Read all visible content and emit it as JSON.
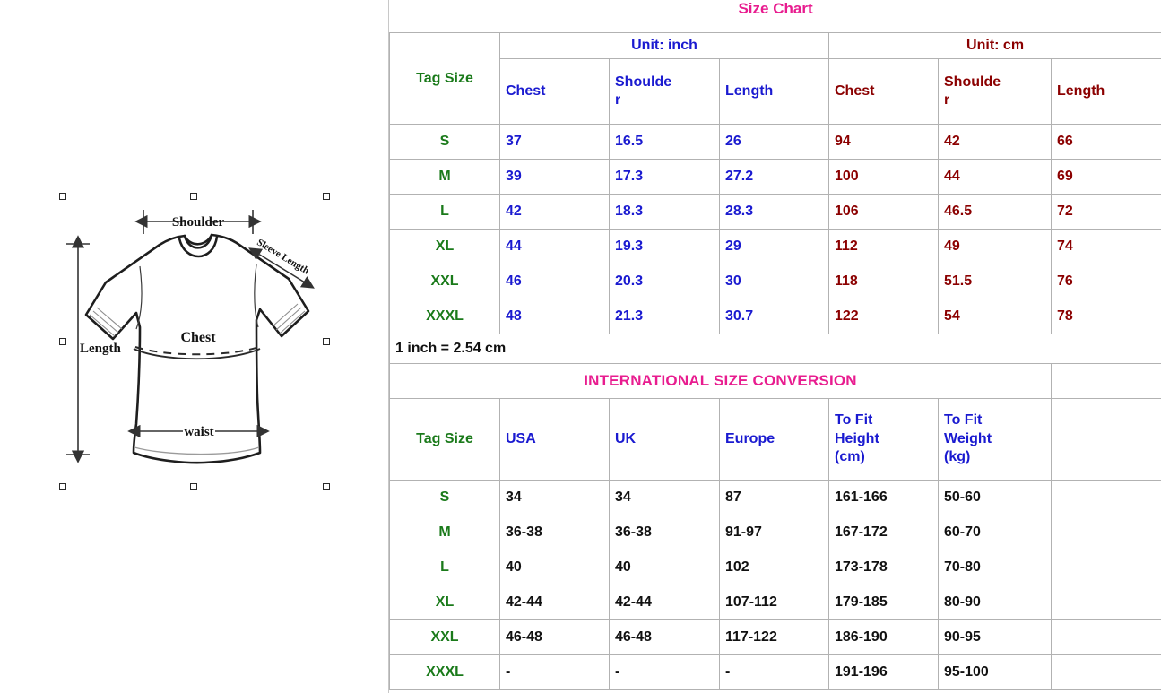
{
  "diagram": {
    "alt_name": "t-shirt-measurement-diagram",
    "labels": {
      "shoulder": "Shoulder",
      "sleeve_length": "Sleeve Length",
      "chest": "Chest",
      "length": "Length",
      "waist": "waist"
    }
  },
  "size_chart": {
    "title": "Size Chart",
    "tag_size_header": "Tag Size",
    "unit_groups": [
      {
        "label": "Unit: inch",
        "columns": [
          "Chest",
          "Shoulder",
          "Length"
        ],
        "color": "#1a1ad0"
      },
      {
        "label": "Unit: cm",
        "columns": [
          "Chest",
          "Shoulder",
          "Length"
        ],
        "color": "#8b0000"
      }
    ],
    "rows": [
      {
        "tag": "S",
        "inch": [
          "37",
          "16.5",
          "26"
        ],
        "cm": [
          "94",
          "42",
          "66"
        ]
      },
      {
        "tag": "M",
        "inch": [
          "39",
          "17.3",
          "27.2"
        ],
        "cm": [
          "100",
          "44",
          "69"
        ]
      },
      {
        "tag": "L",
        "inch": [
          "42",
          "18.3",
          "28.3"
        ],
        "cm": [
          "106",
          "46.5",
          "72"
        ]
      },
      {
        "tag": "XL",
        "inch": [
          "44",
          "19.3",
          "29"
        ],
        "cm": [
          "112",
          "49",
          "74"
        ]
      },
      {
        "tag": "XXL",
        "inch": [
          "46",
          "20.3",
          "30"
        ],
        "cm": [
          "118",
          "51.5",
          "76"
        ]
      },
      {
        "tag": "XXXL",
        "inch": [
          "48",
          "21.3",
          "30.7"
        ],
        "cm": [
          "122",
          "54",
          "78"
        ]
      }
    ],
    "note": "1 inch = 2.54 cm"
  },
  "international": {
    "banner": "INTERNATIONAL SIZE CONVERSION",
    "headers": [
      "Tag Size",
      "USA",
      "UK",
      "Europe",
      "To Fit Height (cm)",
      "To Fit Weight (kg)"
    ],
    "header_lines": {
      "tag_size": "Tag Size",
      "usa": "USA",
      "uk": "UK",
      "europe": "Europe",
      "height_l1": "To Fit",
      "height_l2": "Height",
      "height_l3": "(cm)",
      "weight_l1": "To Fit",
      "weight_l2": "Weight",
      "weight_l3": "(kg)"
    },
    "rows": [
      {
        "tag": "S",
        "usa": "34",
        "uk": "34",
        "europe": "87",
        "height": "161-166",
        "weight": "50-60"
      },
      {
        "tag": "M",
        "usa": "36-38",
        "uk": "36-38",
        "europe": "91-97",
        "height": "167-172",
        "weight": "60-70"
      },
      {
        "tag": "L",
        "usa": "40",
        "uk": "40",
        "europe": "102",
        "height": "173-178",
        "weight": "70-80"
      },
      {
        "tag": "XL",
        "usa": "42-44",
        "uk": "42-44",
        "europe": "107-112",
        "height": "179-185",
        "weight": "80-90"
      },
      {
        "tag": "XXL",
        "usa": "46-48",
        "uk": "46-48",
        "europe": "117-122",
        "height": "186-190",
        "weight": "90-95"
      },
      {
        "tag": "XXXL",
        "usa": "-",
        "uk": "-",
        "europe": "-",
        "height": "191-196",
        "weight": "95-100"
      }
    ]
  },
  "colors": {
    "pink": "#e81c8f",
    "blue": "#1a1ad0",
    "dark_red": "#8b0000",
    "green": "#1a7a1a",
    "black": "#111111",
    "border": "#b2b2b2"
  },
  "shoulder_header_lines": {
    "line1": "Shoulde",
    "line2": "r"
  }
}
